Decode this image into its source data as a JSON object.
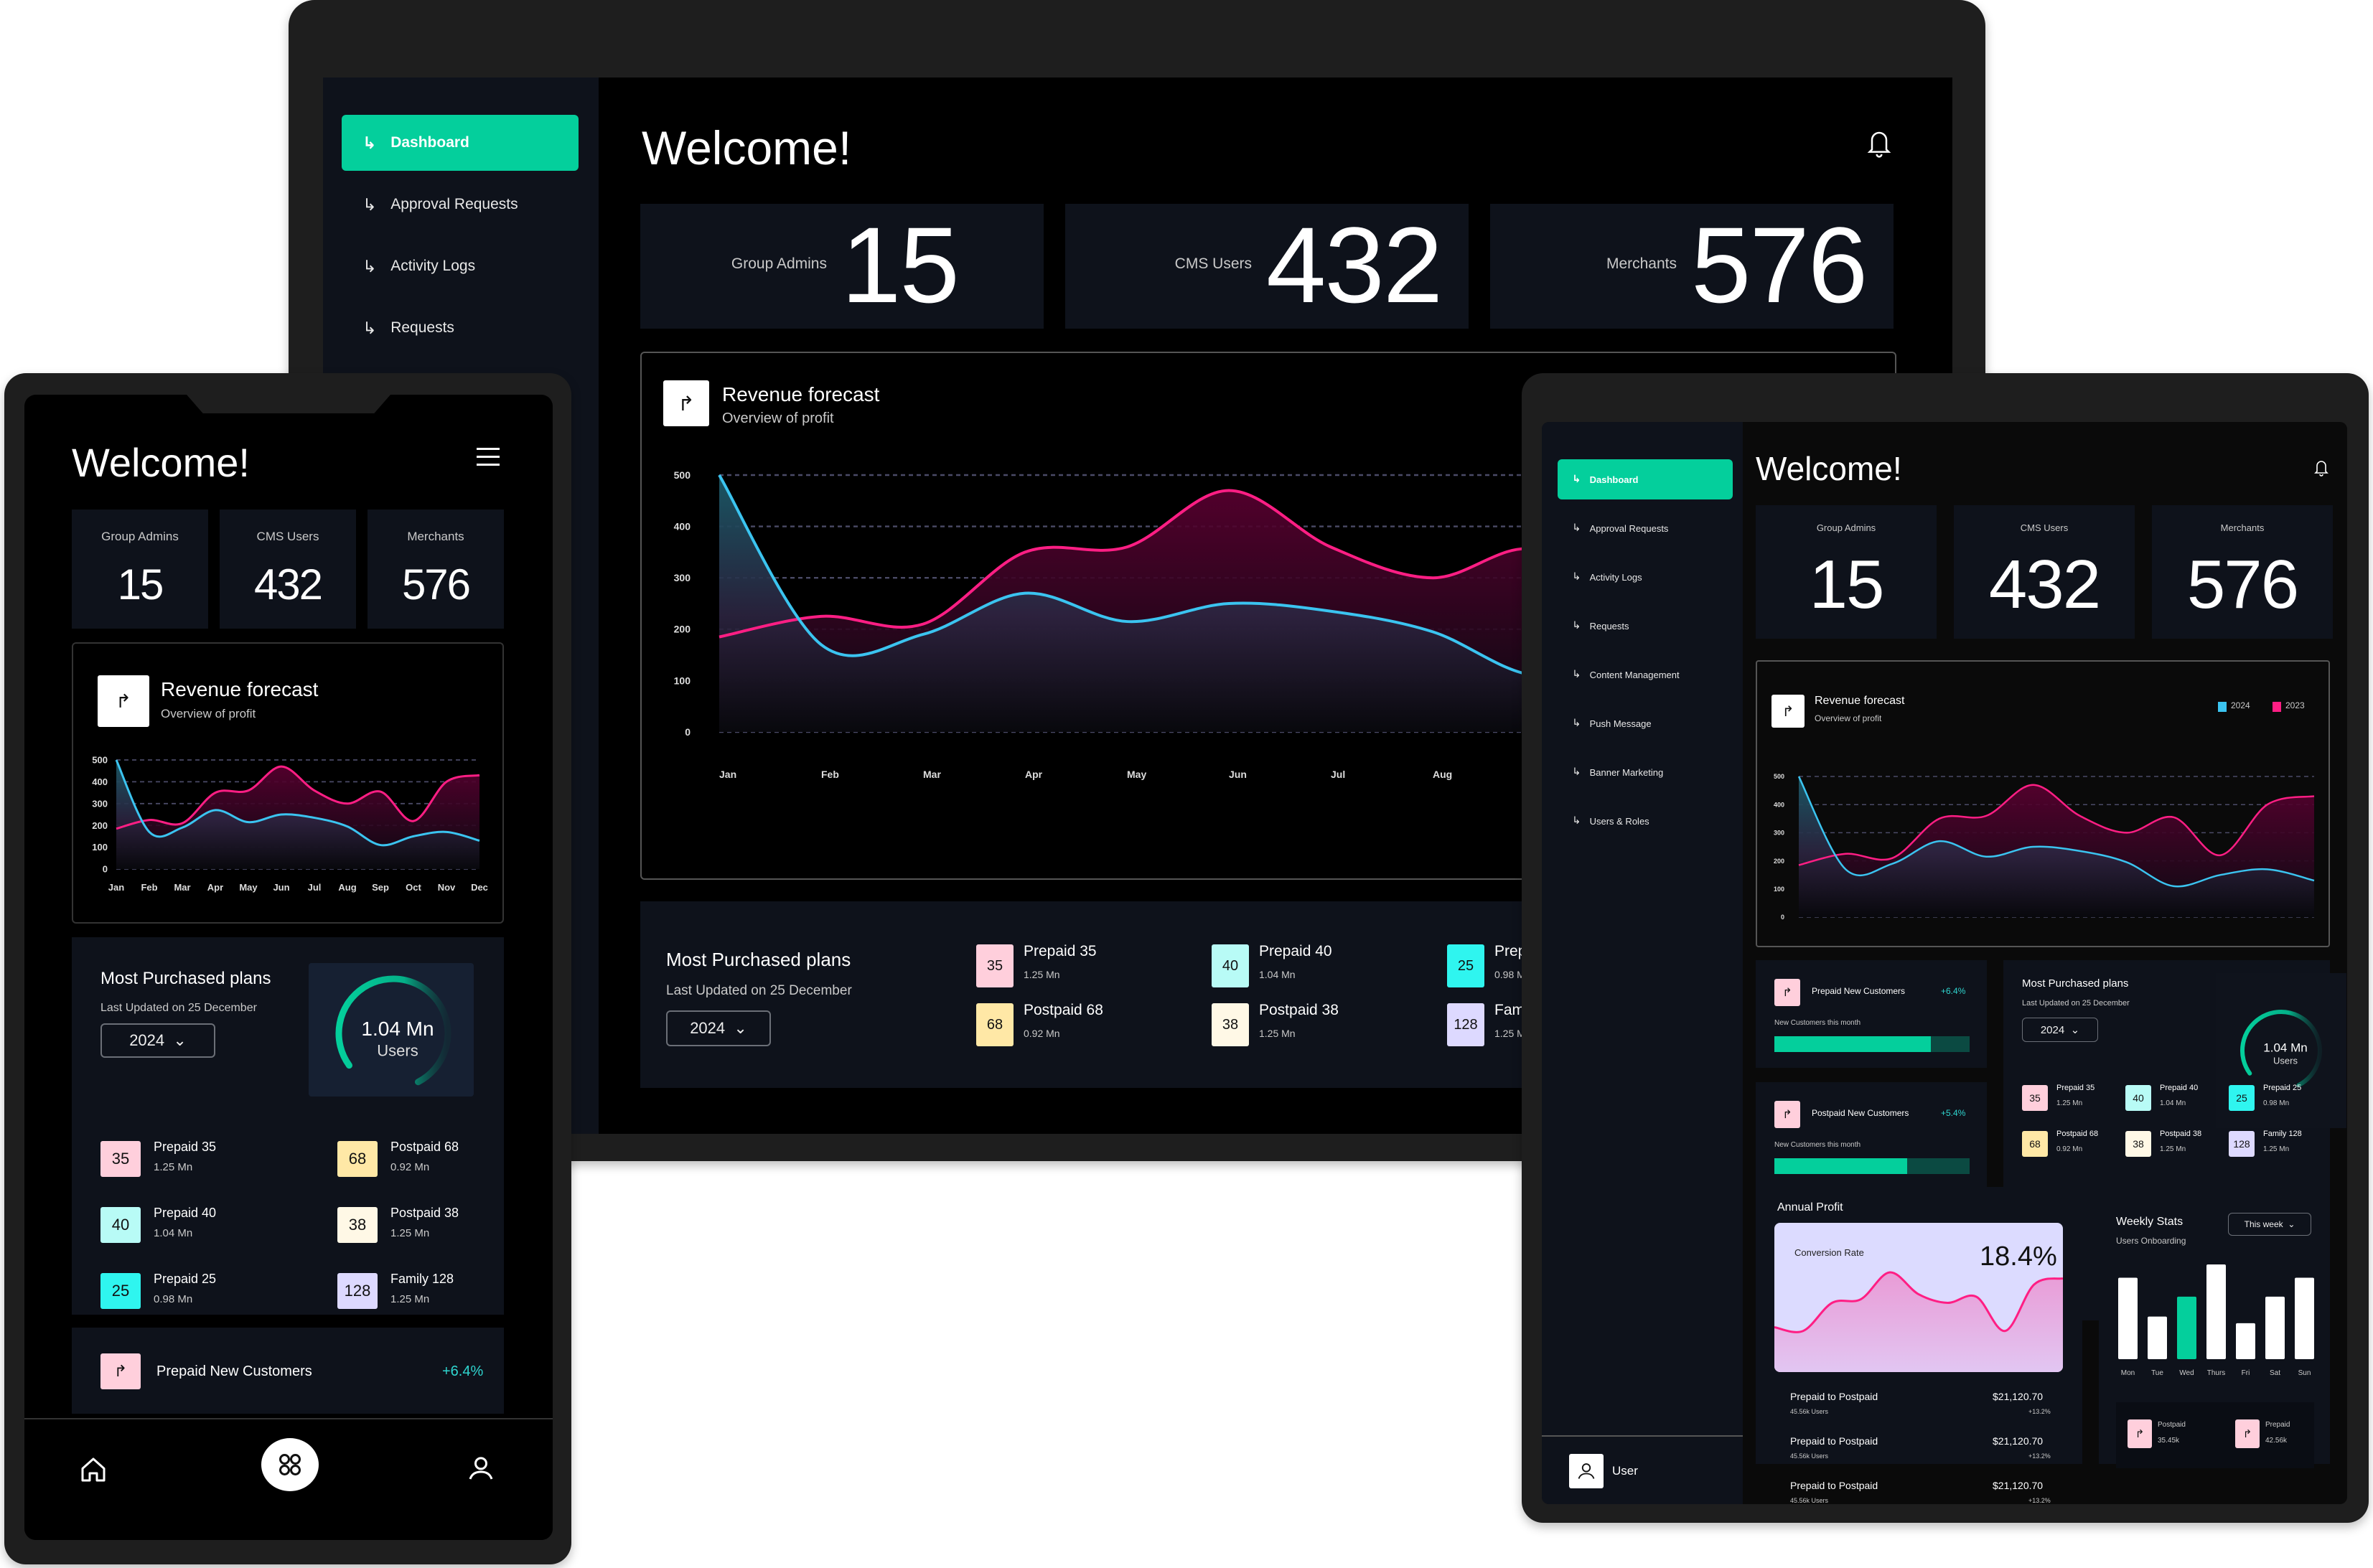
{
  "colors": {
    "accent": "#04cf9c",
    "series_2024": "#3bc4f0",
    "series_2023": "#ff1e84",
    "card_bg": "#0e121b",
    "screen_bg": "#000000"
  },
  "common": {
    "welcome": "Welcome!",
    "stats": [
      {
        "label": "Group Admins",
        "value": "15"
      },
      {
        "label": "CMS Users",
        "value": "432"
      },
      {
        "label": "Merchants",
        "value": "576"
      }
    ],
    "revenue": {
      "title": "Revenue forecast",
      "subtitle": "Overview of profit"
    },
    "plans": {
      "title": "Most Purchased plans",
      "updated": "Last Updated on 25 December",
      "year": "2024",
      "gauge_value": "1.04 Mn",
      "gauge_label": "Users",
      "gauge_fraction": 0.7,
      "items": [
        {
          "code": "35",
          "name": "Prepaid 35",
          "users": "1.25 Mn",
          "color": "#ffcfdc"
        },
        {
          "code": "40",
          "name": "Prepaid 40",
          "users": "1.04 Mn",
          "color": "#b8fbf6"
        },
        {
          "code": "25",
          "name": "Prepaid 25",
          "users": "0.98 Mn",
          "color": "#2ff5ef"
        },
        {
          "code": "68",
          "name": "Postpaid 68",
          "users": "0.92 Mn",
          "color": "#ffe8a6"
        },
        {
          "code": "38",
          "name": "Postpaid 38",
          "users": "1.25 Mn",
          "color": "#fff8e6"
        },
        {
          "code": "128",
          "name": "Family 128",
          "users": "1.25 Mn",
          "color": "#ddd9ff"
        }
      ]
    },
    "new_customers": [
      {
        "title": "Prepaid New Customers",
        "change": "+6.4%",
        "sub": "New Customers this month",
        "progress": 0.8
      },
      {
        "title": "Postpaid New Customers",
        "change": "+5.4%",
        "sub": "New Customers this month",
        "progress": 0.68
      }
    ]
  },
  "laptop": {
    "nav": [
      "Dashboard",
      "Approval Requests",
      "Activity Logs",
      "Requests"
    ],
    "active_nav": "Dashboard"
  },
  "tablet": {
    "nav": [
      "Dashboard",
      "Approval Requests",
      "Activity Logs",
      "Requests",
      "Content Management",
      "Push Message",
      "Banner Marketing",
      "Users & Roles"
    ],
    "user_label": "User",
    "legend": [
      "2024",
      "2023"
    ],
    "annual": {
      "title": "Annual Profit",
      "conversion_label": "Conversion Rate",
      "conversion_value": "18.4%",
      "rows": [
        {
          "title": "Prepaid to Postpaid",
          "amount": "$21,120.70",
          "users": "45.56k Users",
          "change": "+13.2%"
        },
        {
          "title": "Prepaid to Postpaid",
          "amount": "$21,120.70",
          "users": "45.56k Users",
          "change": "+13.2%"
        },
        {
          "title": "Prepaid to Postpaid",
          "amount": "$21,120.70",
          "users": "45.56k Users",
          "change": "+13.2%"
        }
      ]
    },
    "weekly": {
      "title": "Weekly Stats",
      "subtitle": "Users Onboarding",
      "period": "This week",
      "days": [
        "Mon",
        "Tue",
        "Wed",
        "Thurs",
        "Fri",
        "Sat",
        "Sun"
      ],
      "values": [
        86,
        45,
        66,
        100,
        38,
        66,
        86
      ],
      "highlight_index": 2,
      "summary": [
        {
          "label": "Postpaid",
          "value": "35.45k"
        },
        {
          "label": "Prepaid",
          "value": "42.56k"
        }
      ]
    }
  },
  "phone": {
    "bottom_nav": [
      "home",
      "apps",
      "profile"
    ]
  },
  "chart_data": {
    "type": "area",
    "title": "Revenue forecast",
    "subtitle": "Overview of profit",
    "categories": [
      "Jan",
      "Feb",
      "Mar",
      "Apr",
      "May",
      "Jun",
      "Jul",
      "Aug",
      "Sep",
      "Oct",
      "Nov",
      "Dec"
    ],
    "series": [
      {
        "name": "2024",
        "values": [
          500,
          170,
          190,
          270,
          215,
          250,
          235,
          195,
          110,
          150,
          170,
          130
        ]
      },
      {
        "name": "2023",
        "values": [
          185,
          225,
          210,
          350,
          360,
          470,
          360,
          300,
          355,
          220,
          400,
          430
        ]
      }
    ],
    "yticks": [
      0,
      100,
      200,
      300,
      400,
      500
    ],
    "ylim": [
      0,
      500
    ],
    "grid": true,
    "legend": "top-right",
    "conversion_series": [
      25,
      22,
      45,
      48,
      70,
      52,
      45,
      50,
      22,
      60,
      65
    ]
  }
}
